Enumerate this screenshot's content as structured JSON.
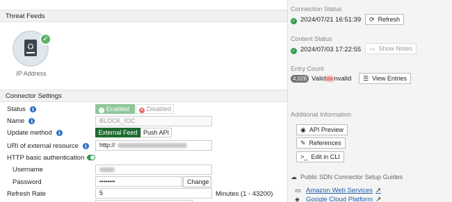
{
  "threat_feeds": {
    "section_title": "Threat Feeds",
    "feed_label": "IP Address"
  },
  "connector_settings": {
    "section_title": "Connector Settings",
    "status": {
      "label": "Status",
      "enabled_label": "Enabled",
      "disabled_label": "Disabled"
    },
    "name": {
      "label": "Name",
      "value": "BLOCK_IOC"
    },
    "update_method": {
      "label": "Update method",
      "external_feed_label": "External Feed",
      "push_api_label": "Push API"
    },
    "uri": {
      "label": "URI of external resource",
      "value_prefix": "http://"
    },
    "http_basic_auth": {
      "label": "HTTP basic authentication"
    },
    "username": {
      "label": "Username"
    },
    "password": {
      "label": "Password",
      "value": "••••••••",
      "change_label": "Change"
    },
    "refresh_rate": {
      "label": "Refresh Rate",
      "value": "5",
      "unit": "Minutes (1 - 43200)"
    }
  },
  "connection_status": {
    "label": "Connection Status",
    "timestamp": "2024/07/21 16:51:39",
    "refresh_label": "Refresh"
  },
  "content_status": {
    "label": "Content Status",
    "timestamp": "2024/07/03 17:22:55",
    "show_notes_label": "Show Notes"
  },
  "entry_count": {
    "label": "Entry Count",
    "count": "4,028",
    "valid_label": "Valid",
    "invalid_label": "nvalid",
    "view_entries_label": "View Entries"
  },
  "additional_info": {
    "label": "Additional Information",
    "api_preview_label": "API Preview",
    "references_label": "References",
    "edit_cli_label": "Edit in CLI"
  },
  "guides": {
    "label": "Public SDN Connector Setup Guides",
    "links": [
      "Amazon Web Services",
      "Google Cloud Platform"
    ]
  },
  "colors": {
    "enabled_green": "#8fc79b",
    "active_segment": "#1f6b2f",
    "info_blue": "#2c6fbf",
    "link_blue": "#1f5fa8"
  }
}
